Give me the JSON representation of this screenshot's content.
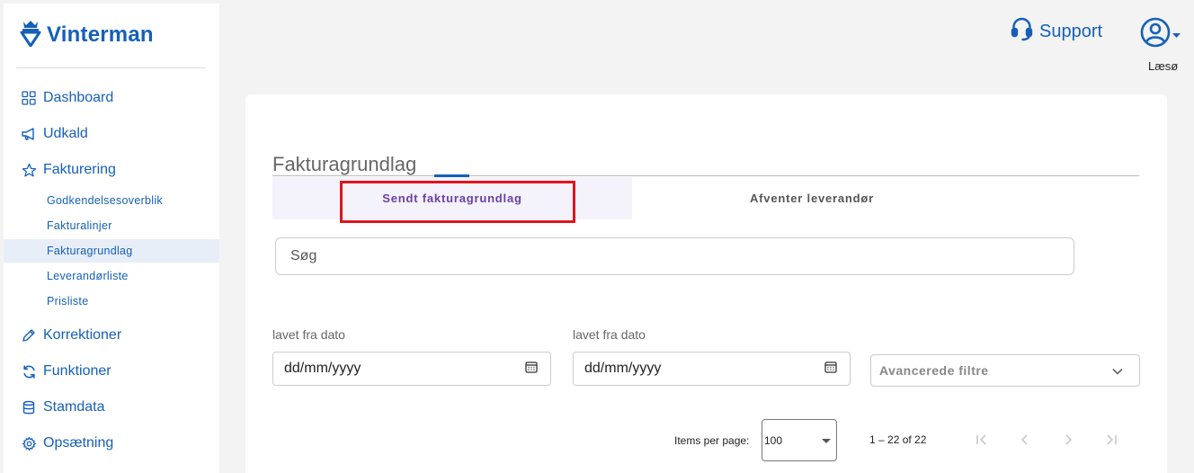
{
  "brand": {
    "name": "Vinterman",
    "color": "#1560b8"
  },
  "nav": {
    "dashboard": "Dashboard",
    "udkald": "Udkald",
    "fakturering": "Fakturering",
    "sub": {
      "godkendelse": "Godkendelsesoverblik",
      "fakturalinjer": "Fakturalinjer",
      "fakturagrundlag": "Fakturagrundlag",
      "leverandorliste": "Leverandørliste",
      "prisliste": "Prisliste"
    },
    "korrektioner": "Korrektioner",
    "funktioner": "Funktioner",
    "stamdata": "Stamdata",
    "opsaetning": "Opsætning"
  },
  "header": {
    "support_label": "Support",
    "user_label": "Læsø"
  },
  "page": {
    "title": "Fakturagrundlag",
    "tabs": [
      "Sendt fakturagrundlag",
      "Afventer leverandør"
    ],
    "search_placeholder": "Søg",
    "date_label_1": "lavet fra dato",
    "date_label_2": "lavet fra dato",
    "date_placeholder": "dd/mm/yyyy",
    "advanced_filters": "Avancerede filtre"
  },
  "paginator": {
    "items_per_page_label": "Items per page:",
    "items_per_page_value": "100",
    "range_label": "1 – 22 of 22"
  },
  "colors": {
    "accent": "#1560b8",
    "active_tab": "#6b3fa3",
    "highlight": "#e0141d"
  }
}
